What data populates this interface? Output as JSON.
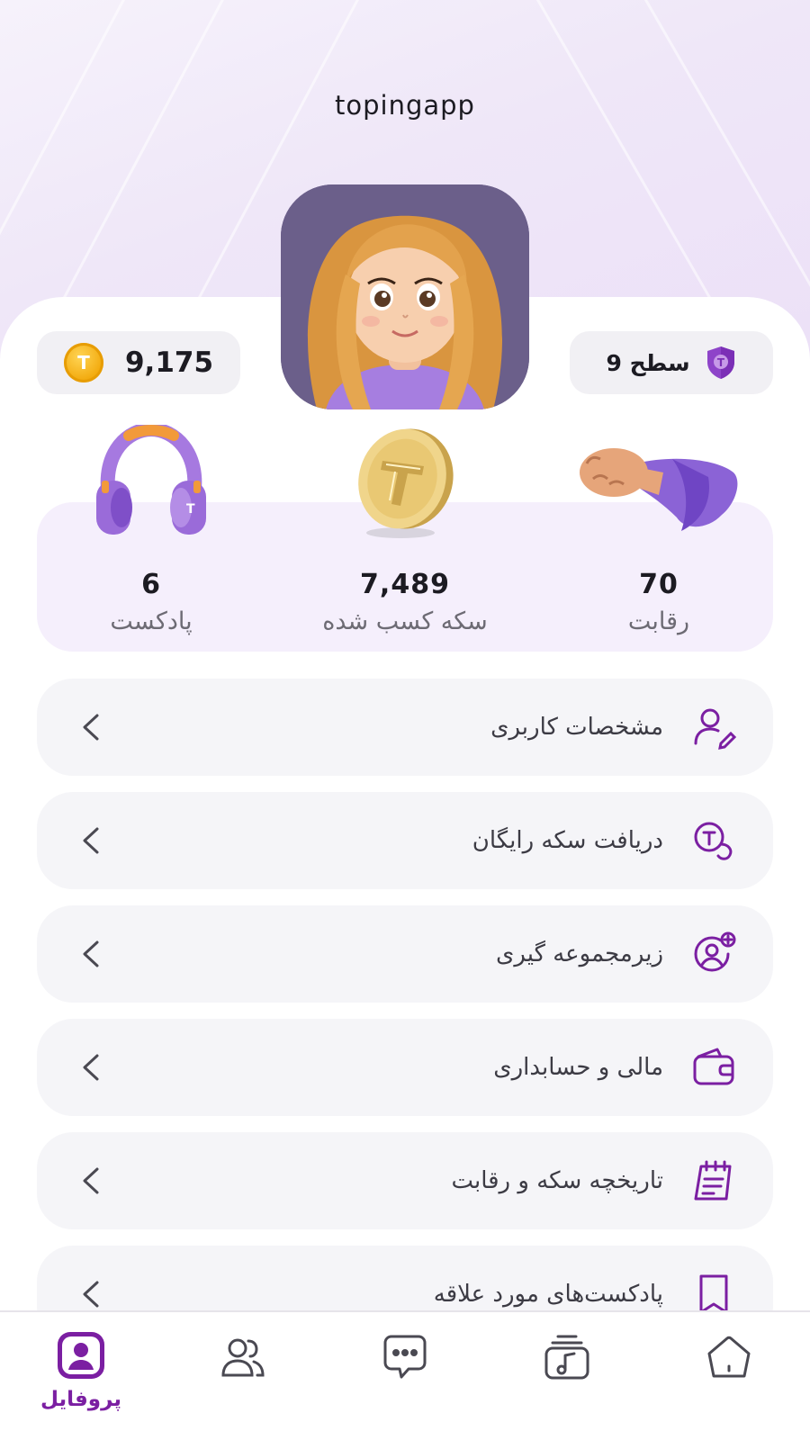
{
  "header": {
    "username": "topingapp"
  },
  "balance": {
    "coins": "9,175",
    "coin_icon": "coin-icon"
  },
  "level": {
    "label": "سطح 9",
    "icon": "shield-icon"
  },
  "stats": [
    {
      "value": "70",
      "label": "رقابت",
      "icon": "fist-icon"
    },
    {
      "value": "7,489",
      "label": "سکه کسب شده",
      "icon": "gold-coin-icon"
    },
    {
      "value": "6",
      "label": "پادکست",
      "icon": "headphones-icon"
    }
  ],
  "menu": [
    {
      "label": "مشخصات کاربری",
      "icon": "user-edit-icon"
    },
    {
      "label": "دریافت سکه رایگان",
      "icon": "free-coin-icon"
    },
    {
      "label": "زیرمجموعه گیری",
      "icon": "add-user-icon"
    },
    {
      "label": "مالی و حسابداری",
      "icon": "wallet-icon"
    },
    {
      "label": "تاریخچه سکه و رقابت",
      "icon": "history-icon"
    },
    {
      "label": "پادکست‌های مورد علاقه",
      "icon": "bookmark-icon"
    }
  ],
  "nav": {
    "active_label": "پروفایل"
  },
  "colors": {
    "accent": "#7B1FA2",
    "stats_bg": "#F5EFFC",
    "item_bg": "#F5F5F8",
    "coin": "#F2A90C"
  }
}
